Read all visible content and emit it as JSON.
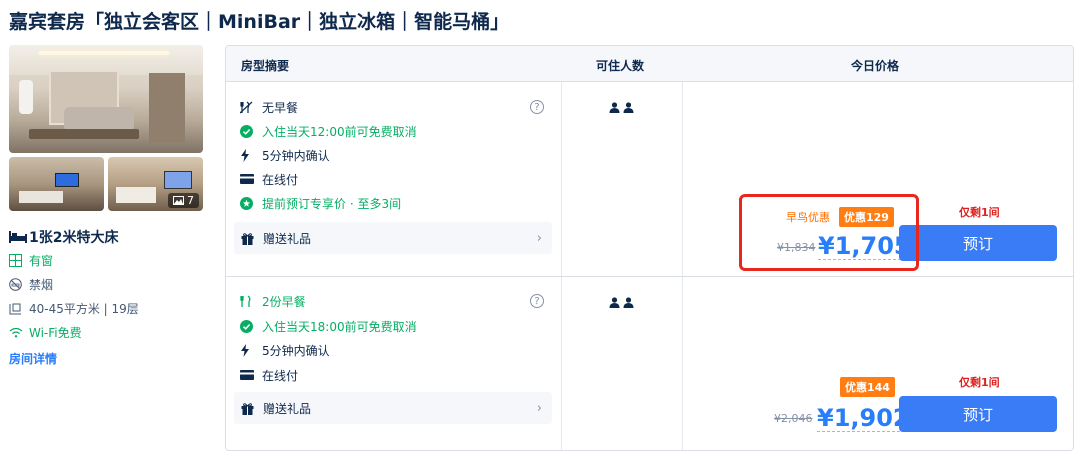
{
  "room": {
    "title": "嘉宾套房「独立会客区｜MiniBar｜独立冰箱｜智能马桶」",
    "photo_count": "7",
    "bed": "1张2米特大床",
    "window": "有窗",
    "smoking": "禁烟",
    "area": "40-45平方米 | 19层",
    "wifi": "Wi-Fi免费",
    "detail_link": "房间详情"
  },
  "table": {
    "col_summary": "房型摘要",
    "col_occupancy": "可住人数",
    "col_price": "今日价格"
  },
  "rates": [
    {
      "meal": "无早餐",
      "cancel": "入住当天12:00前可免费取消",
      "confirm": "5分钟内确认",
      "payment": "在线付",
      "advance": "提前预订专享价 · 至多3间",
      "gift": "赠送礼品",
      "guests": 2,
      "early_tag": "早鸟优惠",
      "discount_tag": "优惠129",
      "remaining": "仅剩1间",
      "old_price": "¥1,834",
      "price": "¥1,705",
      "book": "预订"
    },
    {
      "meal": "2份早餐",
      "cancel": "入住当天18:00前可免费取消",
      "confirm": "5分钟内确认",
      "payment": "在线付",
      "gift": "赠送礼品",
      "guests": 2,
      "discount_tag": "优惠144",
      "remaining": "仅剩1间",
      "old_price": "¥2,046",
      "price": "¥1,902",
      "book": "预订"
    }
  ],
  "colors": {
    "accent": "#287dfa",
    "button": "#3a7cf6",
    "green": "#06ae64",
    "discount": "#ff7d13",
    "warning": "#e02020",
    "highlight": "#e8271e"
  }
}
